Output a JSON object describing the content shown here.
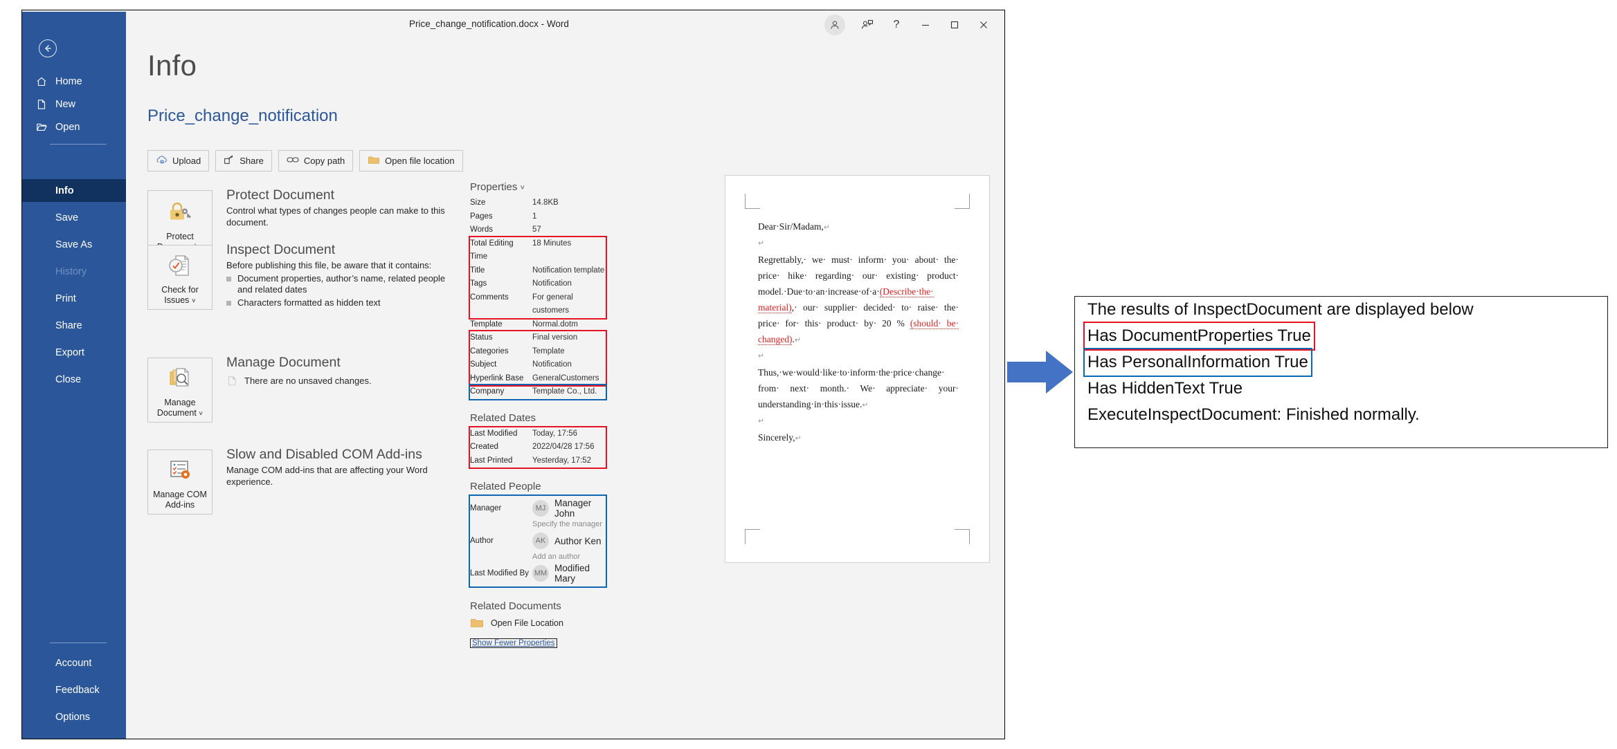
{
  "window": {
    "doc_title": "Price_change_notification.docx  -  Word",
    "controls": [
      {
        "name": "account-icon",
        "glyph": "person"
      },
      {
        "name": "share-user-icon",
        "glyph": "person-share"
      },
      {
        "name": "help-icon",
        "glyph": "?"
      },
      {
        "name": "minimize-icon",
        "glyph": "–"
      },
      {
        "name": "maximize-icon",
        "glyph": "□"
      },
      {
        "name": "close-icon",
        "glyph": "✕"
      }
    ]
  },
  "sidebar": {
    "back_label": "Back",
    "items": [
      {
        "label": "Home",
        "icon": "home-icon"
      },
      {
        "label": "New",
        "icon": "new-document-icon"
      },
      {
        "label": "Open",
        "icon": "open-folder-icon"
      },
      {
        "label": "Info",
        "icon": "",
        "selected": true
      },
      {
        "label": "Save",
        "icon": ""
      },
      {
        "label": "Save As",
        "icon": ""
      },
      {
        "label": "History",
        "icon": "",
        "disabled": true
      },
      {
        "label": "Print",
        "icon": ""
      },
      {
        "label": "Share",
        "icon": ""
      },
      {
        "label": "Export",
        "icon": ""
      },
      {
        "label": "Close",
        "icon": ""
      }
    ],
    "bottom_items": [
      {
        "label": "Account"
      },
      {
        "label": "Feedback"
      },
      {
        "label": "Options"
      }
    ]
  },
  "header": {
    "page_title": "Info",
    "file_name": "Price_change_notification"
  },
  "commands": [
    {
      "label": "Upload",
      "icon": "cloud-upload-icon"
    },
    {
      "label": "Share",
      "icon": "share-icon"
    },
    {
      "label": "Copy path",
      "icon": "link-icon"
    },
    {
      "label": "Open file location",
      "icon": "folder-icon"
    }
  ],
  "sections": [
    {
      "tile_label": "Protect\nDocument",
      "tile_icon": "lock-key-icon",
      "tile_caret": true,
      "heading": "Protect Document",
      "description": "Control what types of changes people can make to this document.",
      "bullets": []
    },
    {
      "tile_label": "Check for\nIssues",
      "tile_icon": "inspect-document-icon",
      "tile_caret": true,
      "heading": "Inspect Document",
      "description": "Before publishing this file, be aware that it contains:",
      "bullets": [
        "Document properties, author’s name, related people and related dates",
        "Characters formatted as hidden text"
      ]
    },
    {
      "tile_label": "Manage\nDocument",
      "tile_icon": "manage-document-icon",
      "tile_caret": true,
      "heading": "Manage Document",
      "description": "",
      "note_icon": "unsaved-file-icon",
      "note": "There are no unsaved changes.",
      "bullets": []
    },
    {
      "tile_label": "Manage COM\nAdd-ins",
      "tile_icon": "com-addins-icon",
      "tile_caret": false,
      "heading": "Slow and Disabled COM Add-ins",
      "description": "Manage COM add-ins that are affecting your Word experience.",
      "bullets": []
    }
  ],
  "properties": {
    "heading": "Properties",
    "caret": "˅",
    "rows": [
      {
        "key": "Size",
        "value": "14.8KB",
        "highlight": ""
      },
      {
        "key": "Pages",
        "value": "1",
        "highlight": ""
      },
      {
        "key": "Words",
        "value": "57",
        "highlight": ""
      },
      {
        "key": "Total Editing Time",
        "value": "18 Minutes",
        "highlight": "red"
      },
      {
        "key": "Title",
        "value": "Notification template",
        "highlight": "red"
      },
      {
        "key": "Tags",
        "value": "Notification",
        "highlight": "red"
      },
      {
        "key": "Comments",
        "value": "For general customers",
        "highlight": "red"
      },
      {
        "key": "Template",
        "value": "Normal.dotm",
        "highlight": ""
      },
      {
        "key": "Status",
        "value": "Final version",
        "highlight": "red"
      },
      {
        "key": "Categories",
        "value": "Template",
        "highlight": "red"
      },
      {
        "key": "Subject",
        "value": "Notification",
        "highlight": "red"
      },
      {
        "key": "Hyperlink Base",
        "value": "GeneralCustomers",
        "highlight": "red"
      },
      {
        "key": "Company",
        "value": "Template Co., Ltd.",
        "highlight": "blue"
      }
    ]
  },
  "related_dates": {
    "heading": "Related Dates",
    "rows": [
      {
        "key": "Last Modified",
        "value": "Today, 17:56"
      },
      {
        "key": "Created",
        "value": "2022/04/28 17:56"
      },
      {
        "key": "Last Printed",
        "value": "Yesterday, 17:52"
      }
    ]
  },
  "related_people": {
    "heading": "Related People",
    "manager_label": "Manager",
    "manager_initials": "MJ",
    "manager_name": "Manager John",
    "manager_hint": "Specify the manager",
    "author_label": "Author",
    "author_initials": "AK",
    "author_name": "Author Ken",
    "author_hint": "Add an author",
    "modified_label": "Last Modified By",
    "modified_initials": "MM",
    "modified_name": "Modified Mary"
  },
  "related_documents": {
    "heading": "Related Documents",
    "open_file_location": "Open File Location",
    "show_fewer": "Show Fewer Properties"
  },
  "preview": {
    "salutation": "Dear·Sir/Madam,",
    "p1_a": "Regrettably,· we· must· inform· you· about· the· price· hike· regarding· our· existing· product· model.·Due·to·an·increase·of·a·",
    "p1_red1": "(Describe·the· material)",
    "p1_b": ",· our· supplier· decided· to· raise· the· price· for· this· product· by· 20 % ",
    "p1_red2": "(should· be· changed)",
    "p1_c": ".",
    "p2": "Thus,·we·would·like·to·inform·the·price·change· from· next· month.· We· appreciate· your· understanding·in·this·issue.",
    "closing": "Sincerely,",
    "pilcrow": "↵"
  },
  "results": {
    "lines": [
      {
        "text": "The results of InspectDocument are displayed below",
        "box": ""
      },
      {
        "text": "Has DocumentProperties True",
        "box": "red"
      },
      {
        "text": "Has PersonalInformation True",
        "box": "blue"
      },
      {
        "text": "Has HiddenText True",
        "box": ""
      },
      {
        "text": "ExecuteInspectDocument: Finished normally.",
        "box": ""
      }
    ]
  },
  "colors": {
    "word_blue": "#2b579a",
    "selected_blue": "#11315e",
    "highlight_red": "#e81123",
    "highlight_blue": "#0b67b2",
    "arrow_blue": "#4472c4"
  }
}
